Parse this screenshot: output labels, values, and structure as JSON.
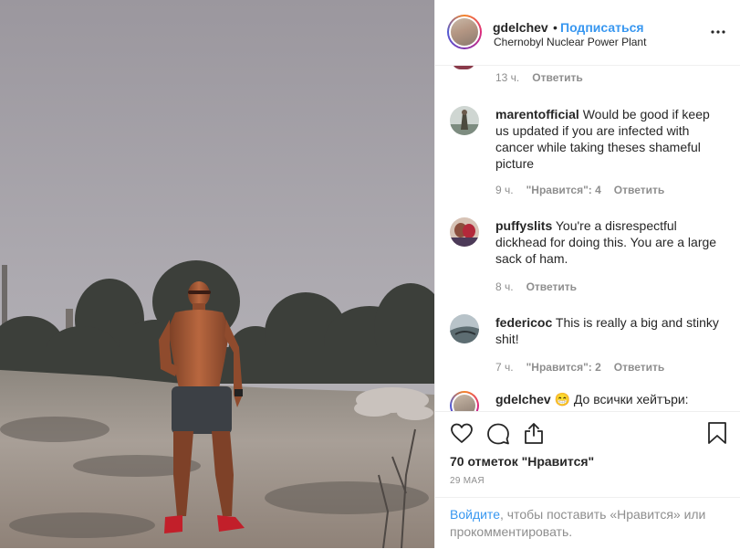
{
  "header": {
    "username": "gdelchev",
    "separator": "•",
    "follow_label": "Подписаться",
    "location": "Chernobyl Nuclear Power Plant"
  },
  "previous_comment": {
    "time": "13 ч.",
    "reply_label": "Ответить"
  },
  "comments": [
    {
      "username": "marentofficial",
      "text": "Would be good if keep us updated if you are infected with cancer while taking theses shameful picture",
      "time": "9 ч.",
      "likes": "\"Нравится\": 4",
      "reply_label": "Ответить"
    },
    {
      "username": "puffyslits",
      "text": "You're a disrespectful dickhead for doing this. You are a large sack of ham.",
      "time": "8 ч.",
      "likes": "",
      "reply_label": "Ответить"
    },
    {
      "username": "federicoc",
      "text": "This is really a big and stinky shit!",
      "time": "7 ч.",
      "likes": "\"Нравится\": 2",
      "reply_label": "Ответить"
    },
    {
      "username": "gdelchev",
      "text": "😁 До всички хейтъри:",
      "time": "",
      "likes": "",
      "reply_label": ""
    }
  ],
  "actions": {
    "icons": [
      "heart-icon",
      "comment-icon",
      "share-icon",
      "bookmark-icon"
    ],
    "likes_text": "70 отметок \"Нравится\"",
    "date": "29 МАЯ"
  },
  "login_prompt": {
    "link_label": "Войдите",
    "rest_text": ", чтобы поставить «Нравится» или прокомментировать."
  },
  "colors": {
    "link_blue": "#3897f0",
    "text": "#262626",
    "muted": "#8e8e8e",
    "border": "#efefef"
  }
}
